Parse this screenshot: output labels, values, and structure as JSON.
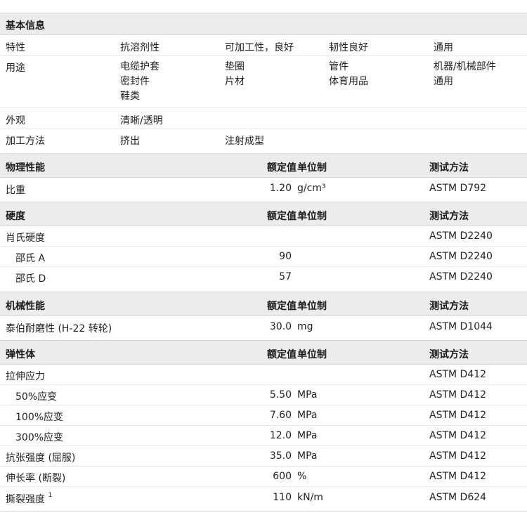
{
  "basic": {
    "title": "基本信息",
    "rows": [
      {
        "label": "特性",
        "cols": [
          "抗溶剂性",
          "可加工性，良好",
          "韧性良好",
          "通用"
        ]
      },
      {
        "label": "用途",
        "cols": [
          [
            "电缆护套",
            "密封件",
            "鞋类"
          ],
          [
            "垫圈",
            "片材"
          ],
          [
            "管件",
            "体育用品"
          ],
          [
            "机器/机械部件",
            "通用"
          ]
        ]
      },
      {
        "label": "外观",
        "cols": [
          "清晰/透明"
        ]
      },
      {
        "label": "加工方法",
        "cols": [
          "挤出",
          "注射成型"
        ]
      }
    ]
  },
  "physical": {
    "title": "物理性能",
    "h_value": "额定值",
    "h_unit": "单位制",
    "h_method": "测试方法",
    "rows": [
      {
        "label": "比重",
        "value": "1.20",
        "unit": "g/cm³",
        "method": "ASTM D792"
      }
    ]
  },
  "hardness": {
    "title": "硬度",
    "h_value": "额定值",
    "h_unit": "单位制",
    "h_method": "测试方法",
    "rows": [
      {
        "label": "肖氏硬度",
        "value": "",
        "unit": "",
        "method": "ASTM D2240"
      },
      {
        "label": "邵氏 A",
        "value": "90",
        "unit": "",
        "method": "ASTM D2240"
      },
      {
        "label": "邵氏 D",
        "value": "57",
        "unit": "",
        "method": "ASTM D2240"
      }
    ]
  },
  "mechanical": {
    "title": "机械性能",
    "h_value": "额定值",
    "h_unit": "单位制",
    "h_method": "测试方法",
    "rows": [
      {
        "label": "泰伯耐磨性 (H-22 转轮)",
        "value": "30.0",
        "unit": "mg",
        "method": "ASTM D1044"
      }
    ]
  },
  "elastomer": {
    "title": "弹性体",
    "h_value": "额定值",
    "h_unit": "单位制",
    "h_method": "测试方法",
    "rows": [
      {
        "label": "拉伸应力",
        "value": "",
        "unit": "",
        "method": "ASTM D412"
      },
      {
        "label": "50%应变",
        "value": "5.50",
        "unit": "MPa",
        "method": "ASTM D412"
      },
      {
        "label": "100%应变",
        "value": "7.60",
        "unit": "MPa",
        "method": "ASTM D412"
      },
      {
        "label": "300%应变",
        "value": "12.0",
        "unit": "MPa",
        "method": "ASTM D412"
      },
      {
        "label": "抗张强度 (屈服)",
        "value": "35.0",
        "unit": "MPa",
        "method": "ASTM D412"
      },
      {
        "label": "伸长率 (断裂)",
        "value": "600",
        "unit": "%",
        "method": "ASTM D412"
      },
      {
        "label": "撕裂强度",
        "sup": "1",
        "value": "110",
        "unit": "kN/m",
        "method": "ASTM D624"
      }
    ]
  }
}
